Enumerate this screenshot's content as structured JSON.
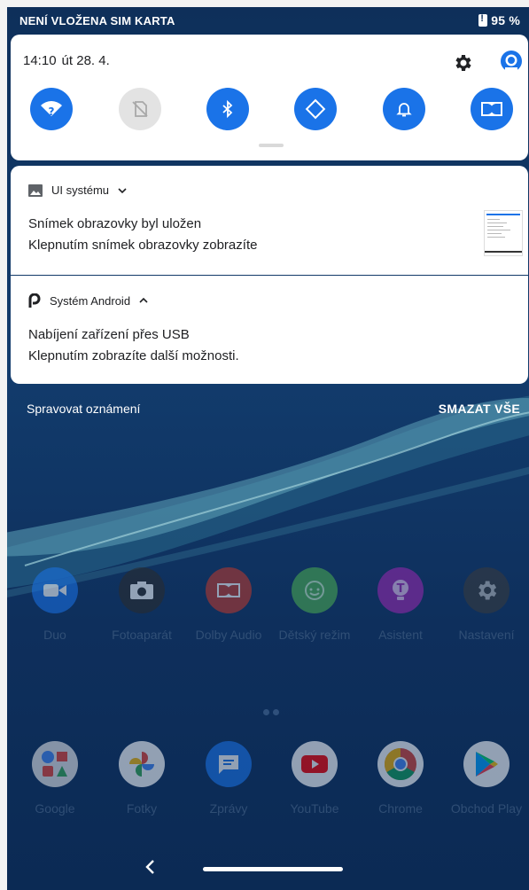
{
  "status_bar": {
    "carrier": "NENÍ VLOŽENA SIM KARTA",
    "battery": "95 %",
    "icons": [
      "battery-alert-icon"
    ]
  },
  "quick_settings": {
    "time": "14:10",
    "date": "út 28. 4.",
    "icons": [
      "settings-gear-icon",
      "account-avatar-icon"
    ],
    "tiles": [
      {
        "name": "wifi",
        "icon": "wifi-question-icon",
        "state": "on"
      },
      {
        "name": "mobile-data",
        "icon": "no-sim-icon",
        "state": "off"
      },
      {
        "name": "bluetooth",
        "icon": "bluetooth-icon",
        "state": "on"
      },
      {
        "name": "auto-rotate",
        "icon": "auto-rotate-icon",
        "state": "on"
      },
      {
        "name": "sound",
        "icon": "bell-icon",
        "state": "on"
      },
      {
        "name": "dolby",
        "icon": "dolby-icon",
        "state": "on"
      }
    ]
  },
  "notifications": [
    {
      "app": "UI systému",
      "app_icon": "image-icon",
      "expand": "collapsed",
      "title": "Snímek obrazovky byl uložen",
      "text": "Klepnutím snímek obrazovky zobrazíte",
      "thumbnail": "screenshot-thumbnail"
    },
    {
      "app": "Systém Android",
      "app_icon": "android-p-icon",
      "expand": "expanded",
      "title": "Nabíjení zařízení přes USB",
      "text": "Klepnutím zobrazíte další možnosti."
    }
  ],
  "footer": {
    "manage": "Spravovat oznámení",
    "clear_all": "SMAZAT VŠE"
  },
  "home": {
    "row1": [
      {
        "label": "Duo",
        "icon": "duo-icon",
        "color": "#1a73e8"
      },
      {
        "label": "Fotoaparát",
        "icon": "camera-icon",
        "color": "#2b2b2b"
      },
      {
        "label": "Dolby Audio",
        "icon": "dolby-audio-icon",
        "color": "#c0392b"
      },
      {
        "label": "Dětský režim",
        "icon": "kids-mode-icon",
        "color": "#4caf50"
      },
      {
        "label": "Asistent",
        "icon": "assistant-icon",
        "color": "#9c27b0"
      },
      {
        "label": "Nastavení",
        "icon": "settings-icon",
        "color": "#3b3b3b"
      }
    ],
    "row2": [
      {
        "label": "Google",
        "icon": "google-folder-icon",
        "color": "#e8e8e8"
      },
      {
        "label": "Fotky",
        "icon": "photos-icon",
        "color": "#ffffff"
      },
      {
        "label": "Zprávy",
        "icon": "messages-icon",
        "color": "#1a73e8"
      },
      {
        "label": "YouTube",
        "icon": "youtube-icon",
        "color": "#ffffff"
      },
      {
        "label": "Chrome",
        "icon": "chrome-icon",
        "color": "#ffffff"
      },
      {
        "label": "Obchod Play",
        "icon": "play-store-icon",
        "color": "#ffffff"
      }
    ]
  },
  "navigation": {
    "icons": [
      "back-icon",
      "home-pill"
    ]
  }
}
